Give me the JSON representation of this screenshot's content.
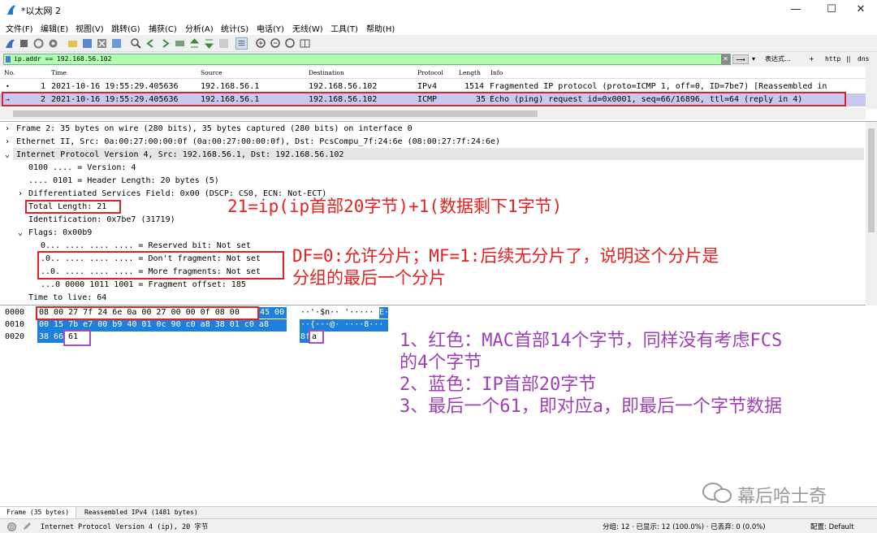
{
  "window": {
    "title": "*以太网 2",
    "minimize": "—",
    "maximize": "☐",
    "close": "✕"
  },
  "menu": [
    "文件(F)",
    "编辑(E)",
    "视图(V)",
    "跳转(G)",
    "捕获(C)",
    "分析(A)",
    "统计(S)",
    "电话(Y)",
    "无线(W)",
    "工具(T)",
    "帮助(H)"
  ],
  "filter": {
    "value": "ip.addr == 192.168.56.102",
    "expression_label": "表达式…",
    "plus": "+",
    "http": "http",
    "dns": "dns"
  },
  "packet_list": {
    "columns": [
      "No.",
      "Time",
      "Source",
      "Destination",
      "Protocol",
      "Length",
      "Info"
    ],
    "rows": [
      {
        "no": "1",
        "time": "2021-10-16 19:55:29.405636",
        "source": "192.168.56.1",
        "destination": "192.168.56.102",
        "protocol": "IPv4",
        "length": "1514",
        "info": "Fragmented IP protocol (proto=ICMP 1, off=0, ID=7be7) [Reassembled in"
      },
      {
        "no": "2",
        "time": "2021-10-16 19:55:29.405636",
        "source": "192.168.56.1",
        "destination": "192.168.56.102",
        "protocol": "ICMP",
        "length": "35",
        "info": "Echo (ping) request  id=0x0001, seq=66/16896, ttl=64 (reply in 4)"
      }
    ]
  },
  "details": [
    "Frame 2: 35 bytes on wire (280 bits), 35 bytes captured (280 bits) on interface 0",
    "Ethernet II, Src: 0a:00:27:00:00:0f (0a:00:27:00:00:0f), Dst: PcsCompu_7f:24:6e (08:00:27:7f:24:6e)",
    "Internet Protocol Version 4, Src: 192.168.56.1, Dst: 192.168.56.102",
    "0100 .... = Version: 4",
    ".... 0101 = Header Length: 20 bytes (5)",
    "Differentiated Services Field: 0x00 (DSCP: CS0, ECN: Not-ECT)",
    "Total Length: 21",
    "Identification: 0x7be7 (31719)",
    "Flags: 0x00b9",
    "0... .... .... .... = Reserved bit: Not set",
    ".0.. .... .... .... = Don't fragment: Not set",
    "..0. .... .... .... = More fragments: Not set",
    "...0 0000 1011 1001 = Fragment offset: 185",
    "Time to live: 64"
  ],
  "bytes": {
    "offsets": [
      "0000",
      "0010",
      "0020"
    ],
    "row1_red": "08 00 27 7f 24 6e 0a 00  27 00 00 0f 08 00",
    "row1_blue": "45 00",
    "row2_blue": "00 15 7b e7 00 b9 40 01  0c 90 c0 a8 38 01 c0 a8",
    "row3_blue": "38 66",
    "row3_last": "61",
    "ascii1_plain": "··'·$n·· '·····",
    "ascii1_blue": "E·",
    "ascii2_blue": "··{···@· ····8···",
    "ascii3_blue": "8f",
    "ascii3_last": "a"
  },
  "annotations": {
    "total_length": "21=ip(ip首部20字节)+1(数据剩下1字节)",
    "flags_line1": "DF=0:允许分片；MF=1:后续无分片了，说明这个分片是",
    "flags_line2": "分组的最后一个分片",
    "bytes_note": [
      "1、红色：MAC首部14个字节，同样没有考虑FCS",
      "的4个字节",
      "2、蓝色：IP首部20字节",
      "3、最后一个61，即对应a，即最后一个字节数据"
    ],
    "watermark": "幕后哈士奇"
  },
  "tabs": [
    "Frame (35 bytes)",
    "Reassembled IPv4 (1481 bytes)"
  ],
  "status": {
    "field": "Internet Protocol Version 4 (ip), 20 字节",
    "packets": "分组: 12 · 已显示: 12 (100.0%) · 已丢弃: 0 (0.0%)",
    "profile": "配置: Default"
  },
  "colors": {
    "filter_ok": "#afffaf",
    "selected_row": "#c8c8f0",
    "bytes_highlight": "#1e80d8",
    "annotation_red": "#e82020",
    "annotation_purple": "#a040b8"
  }
}
